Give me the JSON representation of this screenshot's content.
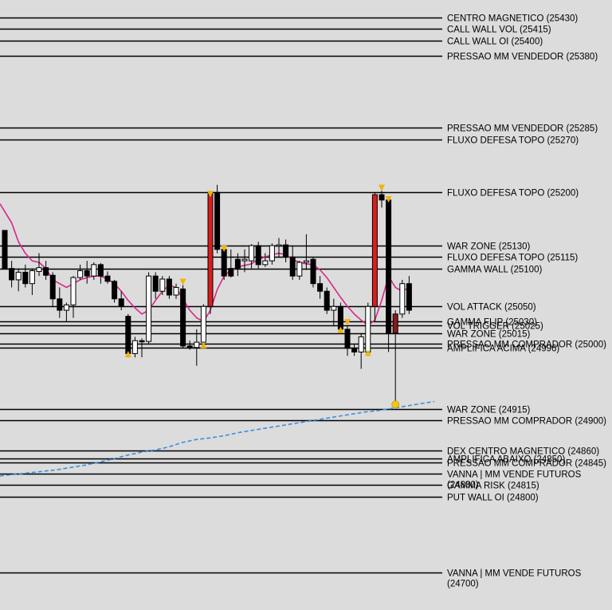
{
  "chart_data": {
    "type": "candlestick",
    "price_range": [
      24700,
      25430
    ],
    "background": "#dcdcdc",
    "colors": {
      "bull_body": "#ffffff",
      "bear_body": "#000000",
      "highlight_body": "#d81e1e",
      "highlight_dark": "#8b1a1a",
      "wick": "#000000",
      "ma_line": "#d6288a",
      "dashed_line": "#3a8fe0",
      "level_line": "#000000",
      "marker_triangle": "#f2b400",
      "marker_dot": "#f5c518"
    },
    "levels": [
      {
        "label": "CENTRO MAGNETICO (25430)",
        "price": 25430
      },
      {
        "label": "CALL WALL VOL (25415)",
        "price": 25415
      },
      {
        "label": "CALL WALL OI (25400)",
        "price": 25400
      },
      {
        "label": "PRESSAO MM VENDEDOR (25380)",
        "price": 25380
      },
      {
        "label": "PRESSAO MM VENDEDOR (25285)",
        "price": 25285
      },
      {
        "label": "FLUXO DEFESA TOPO (25270)",
        "price": 25270
      },
      {
        "label": "FLUXO DEFESA TOPO (25200)",
        "price": 25200
      },
      {
        "label": "WAR ZONE (25130)",
        "price": 25130
      },
      {
        "label": "FLUXO DEFESA TOPO (25115)",
        "price": 25115
      },
      {
        "label": "GAMMA WALL (25100)",
        "price": 25100
      },
      {
        "label": "VOL ATTACK (25050)",
        "price": 25050
      },
      {
        "label": "GAMMA FLIP (25030)",
        "price": 25030
      },
      {
        "label": "VOL TRIGGER (25025)",
        "price": 25025
      },
      {
        "label": "WAR ZONE (25015)",
        "price": 25015
      },
      {
        "label": "PRESSAO MM COMPRADOR (25000)",
        "price": 25001
      },
      {
        "label": "AMPLIFICA ACIMA (24996)",
        "price": 24996
      },
      {
        "label": "WAR ZONE (24915)",
        "price": 24915
      },
      {
        "label": "PRESSAO MM COMPRADOR (24900)",
        "price": 24900
      },
      {
        "label": "DEX CENTRO MAGNETICO (24860)",
        "price": 24860
      },
      {
        "label": "AMPLIFICA ABAIXO (24850)",
        "price": 24850
      },
      {
        "label": "PRESSAO MM COMPRADOR (24845)",
        "price": 24845
      },
      {
        "label": "VANNA | MM VENDE FUTUROS (24830)",
        "price": 24830
      },
      {
        "label": "GAMMA RISK (24815)",
        "price": 24815
      },
      {
        "label": "PUT WALL OI (24800)",
        "price": 24800
      },
      {
        "label": "VANNA | MM VENDE FUTUROS (24700)",
        "price": 24700
      }
    ],
    "candles": [
      {
        "o": 25150,
        "h": 25150,
        "l": 25100,
        "c": 25100,
        "dir": "down"
      },
      {
        "o": 25100,
        "h": 25110,
        "l": 25075,
        "c": 25085,
        "dir": "down"
      },
      {
        "o": 25085,
        "h": 25100,
        "l": 25070,
        "c": 25095,
        "dir": "up"
      },
      {
        "o": 25095,
        "h": 25105,
        "l": 25075,
        "c": 25080,
        "dir": "down"
      },
      {
        "o": 25080,
        "h": 25100,
        "l": 25065,
        "c": 25097,
        "dir": "up"
      },
      {
        "o": 25096,
        "h": 25120,
        "l": 25090,
        "c": 25101,
        "dir": "up"
      },
      {
        "o": 25101,
        "h": 25110,
        "l": 25085,
        "c": 25091,
        "dir": "down"
      },
      {
        "o": 25091,
        "h": 25095,
        "l": 25050,
        "c": 25060,
        "dir": "down"
      },
      {
        "o": 25060,
        "h": 25075,
        "l": 25035,
        "c": 25045,
        "dir": "down"
      },
      {
        "o": 25045,
        "h": 25055,
        "l": 25030,
        "c": 25052,
        "dir": "up"
      },
      {
        "o": 25052,
        "h": 25090,
        "l": 25035,
        "c": 25088,
        "dir": "up"
      },
      {
        "o": 25088,
        "h": 25105,
        "l": 25085,
        "c": 25097,
        "dir": "up"
      },
      {
        "o": 25097,
        "h": 25110,
        "l": 25080,
        "c": 25090,
        "dir": "down"
      },
      {
        "o": 25090,
        "h": 25108,
        "l": 25085,
        "c": 25105,
        "dir": "up"
      },
      {
        "o": 25105,
        "h": 25107,
        "l": 25080,
        "c": 25090,
        "dir": "down"
      },
      {
        "o": 25090,
        "h": 25096,
        "l": 25080,
        "c": 25083,
        "dir": "down"
      },
      {
        "o": 25083,
        "h": 25085,
        "l": 25055,
        "c": 25060,
        "dir": "down"
      },
      {
        "o": 25060,
        "h": 25070,
        "l": 25045,
        "c": 25050,
        "dir": "down"
      },
      {
        "o": 25037,
        "h": 25040,
        "l": 24983,
        "c": 24988,
        "dir": "down"
      },
      {
        "o": 24988,
        "h": 25010,
        "l": 24983,
        "c": 25005,
        "dir": "up"
      },
      {
        "o": 25005,
        "h": 25008,
        "l": 24983,
        "c": 25004,
        "dir": "down"
      },
      {
        "o": 25004,
        "h": 25095,
        "l": 25000,
        "c": 25090,
        "dir": "up"
      },
      {
        "o": 25090,
        "h": 25095,
        "l": 25060,
        "c": 25070,
        "dir": "down"
      },
      {
        "o": 25070,
        "h": 25090,
        "l": 25065,
        "c": 25086,
        "dir": "up"
      },
      {
        "o": 25086,
        "h": 25090,
        "l": 25060,
        "c": 25065,
        "dir": "down"
      },
      {
        "o": 25065,
        "h": 25080,
        "l": 25060,
        "c": 25075,
        "dir": "up"
      },
      {
        "o": 25073,
        "h": 25078,
        "l": 24995,
        "c": 24998,
        "dir": "down"
      },
      {
        "o": 24998,
        "h": 25005,
        "l": 24993,
        "c": 24996,
        "dir": "down"
      },
      {
        "o": 24996,
        "h": 25020,
        "l": 24972,
        "c": 25003,
        "dir": "up"
      },
      {
        "o": 25003,
        "h": 25053,
        "l": 24995,
        "c": 25050,
        "dir": "up"
      },
      {
        "o": 25050,
        "h": 25202,
        "l": 25040,
        "c": 25198,
        "dir": "up",
        "highlight": "red"
      },
      {
        "o": 25200,
        "h": 25210,
        "l": 25120,
        "c": 25125,
        "dir": "down"
      },
      {
        "o": 25125,
        "h": 25130,
        "l": 25085,
        "c": 25090,
        "dir": "down"
      },
      {
        "o": 25090,
        "h": 25125,
        "l": 25088,
        "c": 25100,
        "dir": "down"
      },
      {
        "o": 25100,
        "h": 25120,
        "l": 25090,
        "c": 25112,
        "dir": "down"
      },
      {
        "o": 25112,
        "h": 25125,
        "l": 25095,
        "c": 25110,
        "dir": "up"
      },
      {
        "o": 25110,
        "h": 25132,
        "l": 25100,
        "c": 25130,
        "dir": "up"
      },
      {
        "o": 25130,
        "h": 25135,
        "l": 25100,
        "c": 25105,
        "dir": "down"
      },
      {
        "o": 25105,
        "h": 25120,
        "l": 25102,
        "c": 25110,
        "dir": "up"
      },
      {
        "o": 25110,
        "h": 25133,
        "l": 25105,
        "c": 25130,
        "dir": "up"
      },
      {
        "o": 25130,
        "h": 25140,
        "l": 25115,
        "c": 25131,
        "dir": "up"
      },
      {
        "o": 25131,
        "h": 25138,
        "l": 25108,
        "c": 25115,
        "dir": "down"
      },
      {
        "o": 25115,
        "h": 25130,
        "l": 25085,
        "c": 25090,
        "dir": "down"
      },
      {
        "o": 25090,
        "h": 25110,
        "l": 25085,
        "c": 25108,
        "dir": "up"
      },
      {
        "o": 25108,
        "h": 25145,
        "l": 25098,
        "c": 25110,
        "dir": "up"
      },
      {
        "o": 25112,
        "h": 25115,
        "l": 25075,
        "c": 25080,
        "dir": "down"
      },
      {
        "o": 25080,
        "h": 25090,
        "l": 25060,
        "c": 25070,
        "dir": "down"
      },
      {
        "o": 25070,
        "h": 25075,
        "l": 25040,
        "c": 25045,
        "dir": "down"
      },
      {
        "o": 25045,
        "h": 25060,
        "l": 25025,
        "c": 25050,
        "dir": "up"
      },
      {
        "o": 25050,
        "h": 25055,
        "l": 25015,
        "c": 25020,
        "dir": "down"
      },
      {
        "o": 25020,
        "h": 25025,
        "l": 24985,
        "c": 24995,
        "dir": "down"
      },
      {
        "o": 24995,
        "h": 25000,
        "l": 24985,
        "c": 24990,
        "dir": "down"
      },
      {
        "o": 24990,
        "h": 25015,
        "l": 24968,
        "c": 25010,
        "dir": "up"
      },
      {
        "o": 24990,
        "h": 25055,
        "l": 24985,
        "c": 25050,
        "dir": "up"
      },
      {
        "o": 25050,
        "h": 25200,
        "l": 25030,
        "c": 25197,
        "dir": "up",
        "highlight": "red"
      },
      {
        "o": 25197,
        "h": 25210,
        "l": 25180,
        "c": 25190,
        "dir": "down"
      },
      {
        "o": 25190,
        "h": 25195,
        "l": 24990,
        "c": 25015,
        "dir": "down"
      },
      {
        "o": 25040,
        "h": 25045,
        "l": 24920,
        "c": 25015,
        "dir": "down",
        "highlight": "dark"
      },
      {
        "o": 25040,
        "h": 25085,
        "l": 25035,
        "c": 25080,
        "dir": "up"
      },
      {
        "o": 25080,
        "h": 25090,
        "l": 25040,
        "c": 25045,
        "dir": "down"
      }
    ],
    "ma_line": [
      25185,
      25160,
      25135,
      25120,
      25110,
      25108,
      25100,
      25085,
      25080,
      25075,
      25080,
      25085,
      25088,
      25090,
      25090,
      25086,
      25080,
      25070,
      25058,
      25048,
      25040,
      25045,
      25058,
      25070,
      25078,
      25075,
      25060,
      25045,
      25035,
      25030,
      25045,
      25072,
      25090,
      25098,
      25102,
      25104,
      25106,
      25112,
      25115,
      25118,
      25120,
      25118,
      25112,
      25108,
      25106,
      25105,
      25098,
      25088,
      25075,
      25062,
      25050,
      25040,
      25032,
      25025,
      25032,
      25058,
      25090,
      25075,
      25070,
      25075
    ],
    "blue_line": [
      [
        0,
        24827
      ],
      [
        8,
        24829
      ],
      [
        16,
        24831
      ],
      [
        24,
        24833
      ],
      [
        32,
        24835
      ],
      [
        40,
        24838
      ],
      [
        48,
        24841
      ],
      [
        56,
        24845
      ],
      [
        64,
        24849
      ],
      [
        72,
        24854
      ],
      [
        80,
        24858
      ],
      [
        88,
        24861
      ],
      [
        96,
        24865
      ],
      [
        104,
        24871
      ],
      [
        112,
        24875
      ],
      [
        120,
        24877
      ],
      [
        128,
        24880
      ],
      [
        136,
        24884
      ],
      [
        144,
        24887
      ],
      [
        152,
        24890
      ],
      [
        160,
        24893
      ],
      [
        168,
        24896
      ],
      [
        176,
        24899
      ],
      [
        184,
        24902
      ],
      [
        192,
        24905
      ],
      [
        200,
        24908
      ],
      [
        208,
        24911
      ],
      [
        216,
        24913
      ],
      [
        224,
        24916
      ],
      [
        232,
        24919
      ],
      [
        240,
        24922
      ],
      [
        248,
        24925
      ]
    ],
    "marker_triangles_top": [
      30,
      32,
      55,
      56
    ],
    "marker_triangles_bottom": [
      18,
      29,
      49,
      53
    ],
    "marker_triangles_down": [
      26,
      50
    ],
    "marker_dot": {
      "index": 57,
      "price": 24921
    }
  }
}
